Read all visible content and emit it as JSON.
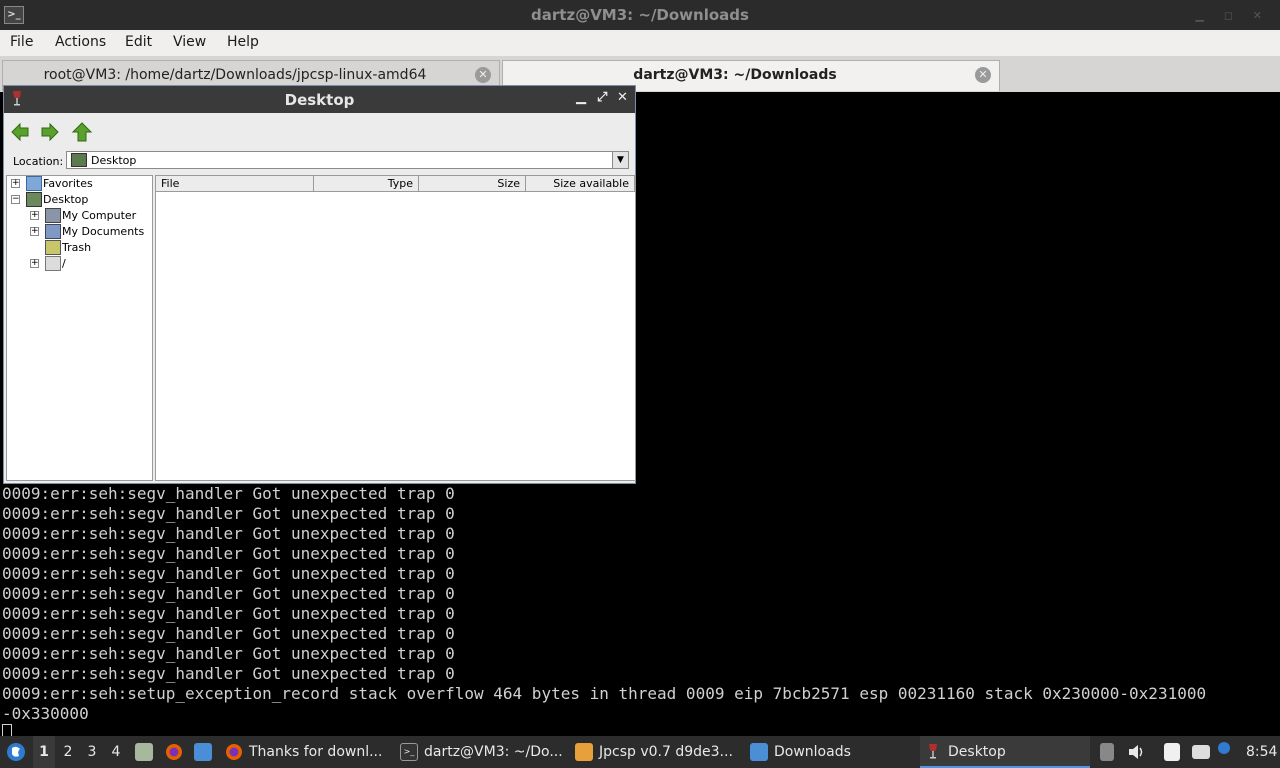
{
  "window": {
    "title": "dartz@VM3: ~/Downloads"
  },
  "menubar": {
    "items": [
      "File",
      "Actions",
      "Edit",
      "View",
      "Help"
    ]
  },
  "tabs": [
    {
      "label": "root@VM3: /home/dartz/Downloads/jpcsp-linux-amd64"
    },
    {
      "label": "dartz@VM3: ~/Downloads"
    }
  ],
  "terminal": {
    "lines": [
      "0009:err:seh:segv_handler Got unexpected trap 0",
      "0009:err:seh:segv_handler Got unexpected trap 0",
      "0009:err:seh:segv_handler Got unexpected trap 0",
      "0009:err:seh:segv_handler Got unexpected trap 0",
      "0009:err:seh:segv_handler Got unexpected trap 0",
      "0009:err:seh:segv_handler Got unexpected trap 0",
      "0009:err:seh:segv_handler Got unexpected trap 0",
      "0009:err:seh:segv_handler Got unexpected trap 0",
      "0009:err:seh:segv_handler Got unexpected trap 0",
      "0009:err:seh:segv_handler Got unexpected trap 0",
      "0009:err:seh:setup_exception_record stack overflow 464 bytes in thread 0009 eip 7bcb2571 esp 00231160 stack 0x230000-0x231000",
      "-0x330000"
    ]
  },
  "explorer": {
    "title": "Desktop",
    "location_label": "Location:",
    "location_value": "Desktop",
    "tree": {
      "favorites": "Favorites",
      "desktop": "Desktop",
      "my_computer": "My Computer",
      "my_documents": "My Documents",
      "trash": "Trash",
      "root": "/"
    },
    "columns": {
      "file": "File",
      "type": "Type",
      "size": "Size",
      "size_available": "Size available"
    }
  },
  "taskbar": {
    "workspaces": [
      "1",
      "2",
      "3",
      "4"
    ],
    "tasks": [
      {
        "label": "Thanks for downl..."
      },
      {
        "label": "dartz@VM3: ~/Do..."
      },
      {
        "label": "Jpcsp v0.7 d9de3..."
      },
      {
        "label": "Downloads"
      },
      {
        "label": "Desktop"
      }
    ],
    "clock": "8:54"
  }
}
